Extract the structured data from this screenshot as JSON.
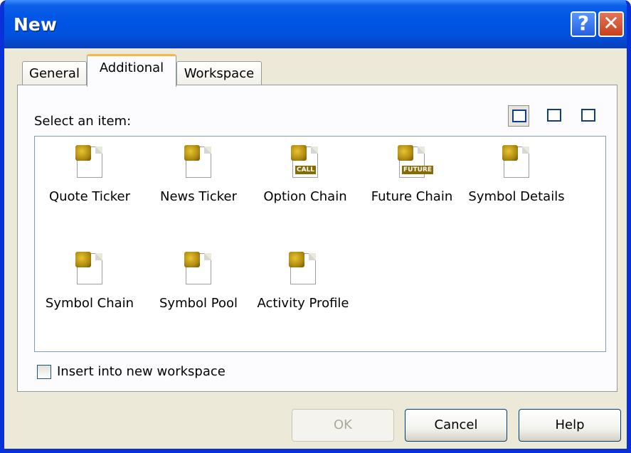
{
  "window": {
    "title": "New"
  },
  "titlebar_buttons": {
    "help": "?",
    "close": "✕"
  },
  "tabs": [
    {
      "label": "General",
      "active": false
    },
    {
      "label": "Additional",
      "active": true
    },
    {
      "label": "Workspace",
      "active": false
    }
  ],
  "panel": {
    "select_label": "Select an item:"
  },
  "view_buttons": [
    {
      "icon": "large-icons-view-icon",
      "selected": true
    },
    {
      "icon": "small-icons-view-icon",
      "selected": false
    },
    {
      "icon": "details-view-icon",
      "selected": false
    }
  ],
  "items": [
    {
      "label": "Quote Ticker",
      "icon": "quote-ticker-icon",
      "badge": ""
    },
    {
      "label": "News Ticker",
      "icon": "news-ticker-icon",
      "badge": ""
    },
    {
      "label": "Option Chain",
      "icon": "option-chain-icon",
      "badge": "CALL"
    },
    {
      "label": "Future Chain",
      "icon": "future-chain-icon",
      "badge": "FUTURE"
    },
    {
      "label": "Symbol Details",
      "icon": "symbol-details-icon",
      "badge": ""
    },
    {
      "label": "Symbol Chain",
      "icon": "symbol-chain-icon",
      "badge": ""
    },
    {
      "label": "Symbol Pool",
      "icon": "symbol-pool-icon",
      "badge": ""
    },
    {
      "label": "Activity Profile",
      "icon": "activity-profile-icon",
      "badge": ""
    }
  ],
  "checkbox": {
    "label": "Insert into new workspace",
    "checked": false
  },
  "buttons": {
    "ok": "OK",
    "cancel": "Cancel",
    "help": "Help"
  },
  "colors": {
    "titlebar": "#0055e5",
    "dialog_bg": "#ece9d8",
    "active_tab_accent": "#f5b74a",
    "list_border": "#7f9db9"
  }
}
